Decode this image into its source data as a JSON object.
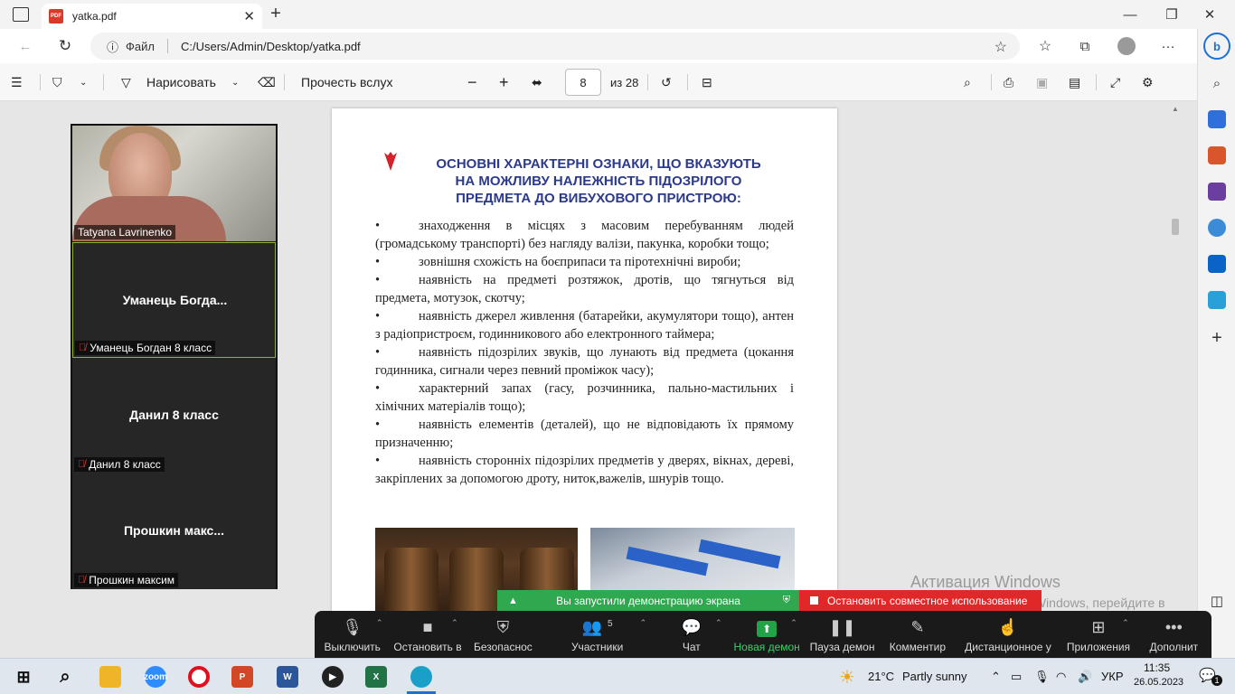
{
  "browser": {
    "tab_title": "yatka.pdf",
    "url_scheme": "Файл",
    "url": "C:/Users/Admin/Desktop/yatka.pdf"
  },
  "pdf_toolbar": {
    "draw_label": "Нарисовать",
    "read_aloud_label": "Прочесть вслух",
    "page_number": "8",
    "page_total": "из 28"
  },
  "document": {
    "title": [
      "ОСНОВНІ ХАРАКТЕРНІ ОЗНАКИ, ЩО ВКАЗУЮТЬ",
      "НА МОЖЛИВУ НАЛЕЖНІСТЬ ПІДОЗРІЛОГО",
      "ПРЕДМЕТА ДО ВИБУХОВОГО ПРИСТРОЮ:"
    ],
    "bullet": "•",
    "items": [
      "знаходження в місцях з масовим перебуванням людей (громадському транспорті) без нагляду валізи, пакунка, коробки тощо;",
      "зовнішня схожість на боєприпаси та піротехнічні вироби;",
      "наявність на предметі розтяжок, дротів, що тягнуться від предмета, мотузок, скотчу;",
      "наявність джерел живлення (батарейки, акумулятори тощо), антен з радіопристроєм, годинникового або електронного таймера;",
      "наявність підозрілих звуків, що лунають від предмета (цокання годинника, сигнали через певний проміжок часу);",
      "характерний запах (гасу, розчинника, пально-мастильних і хімічних матеріалів тощо);",
      "наявність елементів (деталей), що не відповідають їх прямому призначенню;",
      "наявність сторонніх підозрілих предметів у дверях, вікнах, дереві, закріплених за допомогою дроту, ниток,важелів, шнурів тощо."
    ]
  },
  "video_panel": [
    {
      "name": "",
      "label": "Tatyana Lavrinenko",
      "muted": false
    },
    {
      "name": "Уманець  Богда...",
      "label": "Уманець Богдан 8 класс",
      "muted": true
    },
    {
      "name": "Данил 8 класс",
      "label": "Данил 8 класс",
      "muted": true
    },
    {
      "name": "Прошкин  макс...",
      "label": "Прошкин максим",
      "muted": true
    }
  ],
  "share": {
    "green": "Вы запустили демонстрацию экрана",
    "red": "Остановить совместное использование"
  },
  "activation": {
    "title": "Активация Windows",
    "sub": "Чтобы активировать Windows, перейдите в раздел \"Параметры\"."
  },
  "zoom_bar": [
    {
      "label": "Выключить",
      "icon": "🎙",
      "caret": true
    },
    {
      "label": "Остановить в",
      "icon": "■",
      "caret": true
    },
    {
      "label": "Безопаснос",
      "icon": "⛨",
      "caret": false
    },
    {
      "label": "Участники",
      "icon": "👥",
      "count": "5",
      "caret": true
    },
    {
      "label": "Чат",
      "icon": "💬",
      "caret": true
    },
    {
      "label": "Новая демон",
      "icon": "⬆",
      "caret": true
    },
    {
      "label": "Пауза демон",
      "icon": "❚❚",
      "caret": false
    },
    {
      "label": "Комментир",
      "icon": "✎",
      "caret": false
    },
    {
      "label": "Дистанционное у",
      "icon": "☝",
      "caret": false
    },
    {
      "label": "Приложения",
      "icon": "⊞",
      "caret": true
    },
    {
      "label": "Дополнит",
      "icon": "•••",
      "caret": false
    }
  ],
  "taskbar": {
    "weather_temp": "21°C",
    "weather_desc": "Partly sunny",
    "lang": "УКР",
    "time": "11:35",
    "date": "26.05.2023",
    "notif_count": "1"
  },
  "colors": {
    "title_blue": "#2b3a8c",
    "share_green": "#2fa84f",
    "share_red": "#e02828",
    "zoom_green": "#22a347"
  }
}
